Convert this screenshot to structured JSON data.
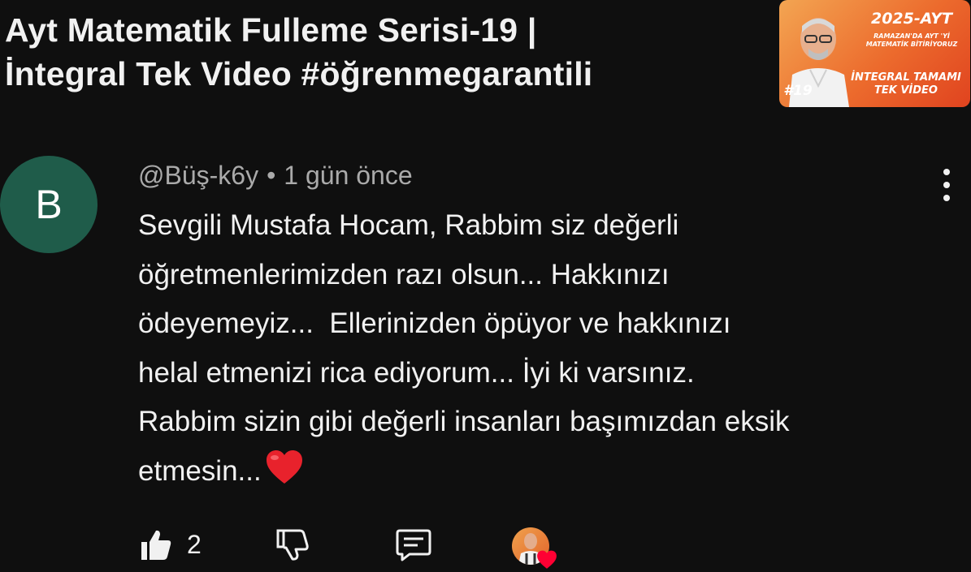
{
  "video": {
    "title_line1": "Ayt Matematik Fulleme Serisi-19 |",
    "title_line2": "İntegral Tek Video #öğrenmegarantili"
  },
  "thumbnail": {
    "year_badge": "2025-AYT",
    "subtitle": "RAMAZAN'DA AYT 'Yİ MATEMATİK BİTİRİYORUZ",
    "episode": "#19",
    "main_text_line1": "İNTEGRAL TAMAMI",
    "main_text_line2": "TEK VİDEO",
    "bg_color": "#ec6b2d"
  },
  "comment": {
    "avatar_letter": "B",
    "avatar_color": "#1f5c4a",
    "author": "@Büş-k6y",
    "separator": "•",
    "time": "1 gün önce",
    "text_lines": [
      "Sevgili Mustafa Hocam, Rabbim siz değerli",
      "öğretmenlerimizden razı olsun... Hakkınızı",
      "ödeyemeyiz...  Ellerinizden öpüyor ve hakkınızı",
      "helal etmenizi rica ediyorum... İyi ki varsınız.",
      "Rabbim sizin gibi değerli insanları başımızdan eksik",
      "etmesin..."
    ],
    "like_count": "2"
  },
  "icons": {
    "like": "thumbs-up-icon",
    "dislike": "thumbs-down-icon",
    "reply": "comment-reply-icon",
    "more": "more-vertical-icon",
    "creator_heart": "creator-heart-icon",
    "heart_emoji": "red-heart-icon"
  }
}
